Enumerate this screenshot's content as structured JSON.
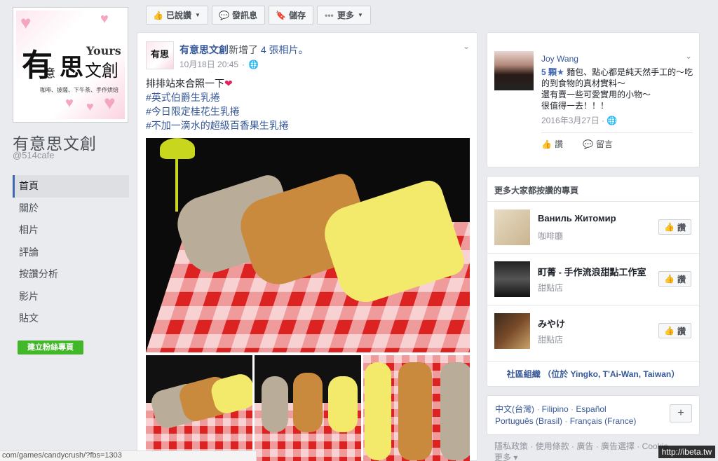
{
  "page": {
    "name": "有意思文創",
    "handle": "@514cafe",
    "logo": {
      "big": "有",
      "small": "意",
      "si": "思",
      "wen": "文創",
      "yours": "Yours",
      "tagline": "咖啡、披薩、下午茶、手作烘焙"
    }
  },
  "sidebar": {
    "items": [
      {
        "label": "首頁",
        "active": true
      },
      {
        "label": "關於"
      },
      {
        "label": "相片"
      },
      {
        "label": "評論"
      },
      {
        "label": "按讚分析"
      },
      {
        "label": "影片"
      },
      {
        "label": "貼文"
      }
    ],
    "create_button": "建立粉絲專頁"
  },
  "actionbar": {
    "liked": "已說讚",
    "message": "發訊息",
    "save": "儲存",
    "more": "更多"
  },
  "post": {
    "author": "有意思文創",
    "action": "新增了",
    "count": "4 張相片。",
    "date": "10月18日 20:45",
    "lines": [
      "排排站來合照一下",
      "#英式伯爵生乳捲",
      "#今日限定桂花生乳捲",
      "#不加一滴水的超級百香果生乳捲"
    ]
  },
  "review": {
    "name": "Joy Wang",
    "stars": "5 顆★",
    "text1": " 麵包、點心都是純天然手工的～吃的到食物的真材實料～",
    "text2": "還有賣一些可愛實用的小物～",
    "text3": "很值得一去！！！",
    "date": "2016年3月27日",
    "like": "讚",
    "comment": "留言"
  },
  "liked_pages": {
    "title": "更多大家都按讚的專頁",
    "items": [
      {
        "name": "Ваниль Житомир",
        "category": "咖啡廳",
        "button": "讚"
      },
      {
        "name": "町菁 - 手作流浪甜點工作室",
        "category": "甜點店",
        "button": "讚"
      },
      {
        "name": "みやけ",
        "category": "甜點店",
        "button": "讚"
      }
    ],
    "footer": "社區組織 （位於 Yingko, T'Ai-Wan, Taiwan）"
  },
  "languages": {
    "l1": "中文(台灣)",
    "l2": "Filipino",
    "l3": "Español",
    "l4": "Português (Brasil)",
    "l5": "Français (France)",
    "sep": " · ",
    "plus": "+"
  },
  "footer": {
    "text": "隱私政策 · 使用條款 · 廣告 · 廣告選擇 · Cookie",
    "more": "更多 ▾"
  },
  "statusbar": "com/games/candycrush/?fbs=1303",
  "watermark": "http://ibeta.tw",
  "colors": {
    "link": "#365899",
    "accent": "#4267b2",
    "green": "#42b72a",
    "bg": "#e9ebee"
  }
}
